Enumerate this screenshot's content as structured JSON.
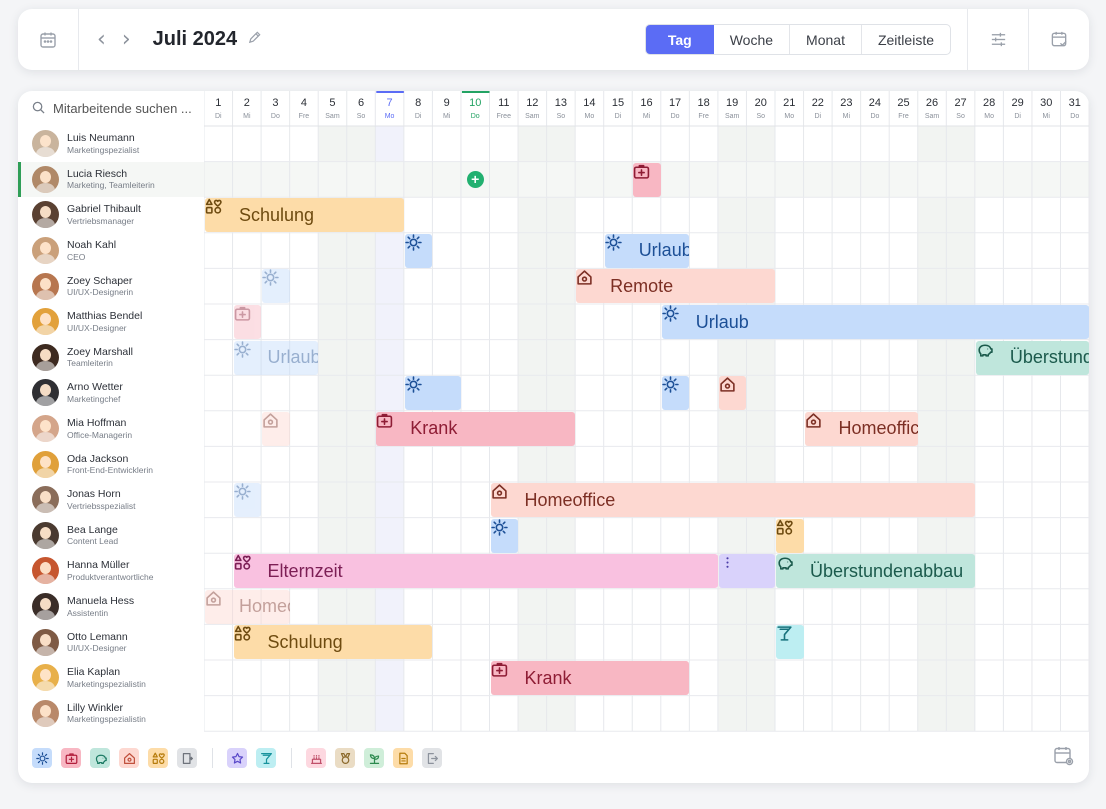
{
  "header": {
    "title": "Juli 2024",
    "views": [
      "Tag",
      "Woche",
      "Monat",
      "Zeitleiste"
    ],
    "active_view": "Tag"
  },
  "search": {
    "placeholder": "Mitarbeitende suchen ..."
  },
  "days": [
    {
      "n": "1",
      "w": "Di"
    },
    {
      "n": "2",
      "w": "Mi"
    },
    {
      "n": "3",
      "w": "Do"
    },
    {
      "n": "4",
      "w": "Fre"
    },
    {
      "n": "5",
      "w": "Sam"
    },
    {
      "n": "6",
      "w": "So"
    },
    {
      "n": "7",
      "w": "Mo"
    },
    {
      "n": "8",
      "w": "Di"
    },
    {
      "n": "9",
      "w": "Mi"
    },
    {
      "n": "10",
      "w": "Do"
    },
    {
      "n": "11",
      "w": "Free"
    },
    {
      "n": "12",
      "w": "Sam"
    },
    {
      "n": "13",
      "w": "So"
    },
    {
      "n": "14",
      "w": "Mo"
    },
    {
      "n": "15",
      "w": "Di"
    },
    {
      "n": "16",
      "w": "Mi"
    },
    {
      "n": "17",
      "w": "Do"
    },
    {
      "n": "18",
      "w": "Fre"
    },
    {
      "n": "19",
      "w": "Sam"
    },
    {
      "n": "20",
      "w": "So"
    },
    {
      "n": "21",
      "w": "Mo"
    },
    {
      "n": "22",
      "w": "Di"
    },
    {
      "n": "23",
      "w": "Mi"
    },
    {
      "n": "24",
      "w": "Do"
    },
    {
      "n": "25",
      "w": "Fre"
    },
    {
      "n": "26",
      "w": "Sam"
    },
    {
      "n": "27",
      "w": "So"
    },
    {
      "n": "28",
      "w": "Mo"
    },
    {
      "n": "29",
      "w": "Di"
    },
    {
      "n": "30",
      "w": "Mi"
    },
    {
      "n": "31",
      "w": "Do"
    }
  ],
  "weekend_days": [
    5,
    6,
    12,
    13,
    19,
    20,
    26,
    27
  ],
  "highlight_day": 7,
  "today": 10,
  "employees": [
    {
      "name": "Luis Neumann",
      "role": "Marketingspezialist",
      "avatar": "#c9b49d"
    },
    {
      "name": "Lucia Riesch",
      "role": "Marketing, Teamleiterin",
      "avatar": "#b08968",
      "selected": true
    },
    {
      "name": "Gabriel Thibault",
      "role": "Vertriebsmanager",
      "avatar": "#5a4132"
    },
    {
      "name": "Noah Kahl",
      "role": "CEO",
      "avatar": "#caa07a"
    },
    {
      "name": "Zoey Schaper",
      "role": "UI/UX-Designerin",
      "avatar": "#b7764f"
    },
    {
      "name": "Matthias Bendel",
      "role": "UI/UX-Designer",
      "avatar": "#e2a13b"
    },
    {
      "name": "Zoey Marshall",
      "role": "Teamleiterin",
      "avatar": "#3d2a20"
    },
    {
      "name": "Arno Wetter",
      "role": "Marketingchef",
      "avatar": "#2f2f33"
    },
    {
      "name": "Mia Hoffman",
      "role": "Office-Managerin",
      "avatar": "#d4a58a"
    },
    {
      "name": "Oda Jackson",
      "role": "Front-End-Entwicklerin",
      "avatar": "#e0a03a"
    },
    {
      "name": "Jonas Horn",
      "role": "Vertriebsspezialist",
      "avatar": "#8a6d5a"
    },
    {
      "name": "Bea Lange",
      "role": "Content Lead",
      "avatar": "#4a3a30"
    },
    {
      "name": "Hanna Müller",
      "role": "Produktverantwortliche",
      "avatar": "#c6562f"
    },
    {
      "name": "Manuela Hess",
      "role": "Assistentin",
      "avatar": "#3a2d28"
    },
    {
      "name": "Otto Lemann",
      "role": "UI/UX-Designer",
      "avatar": "#7e5a44"
    },
    {
      "name": "Elia Kaplan",
      "role": "Marketingspezialistin",
      "avatar": "#e8b04a"
    },
    {
      "name": "Lilly Winkler",
      "role": "Marketingspezialistin",
      "avatar": "#b9896a"
    }
  ],
  "absence_types": {
    "urlaub": {
      "bg": "#c5dcfb",
      "fg": "#1c4f96",
      "icon": "sun-icon"
    },
    "krank": {
      "bg": "#f8b7c3",
      "fg": "#8e1d35",
      "icon": "medical-case-icon"
    },
    "schulung": {
      "bg": "#fddca8",
      "fg": "#6e4b10",
      "icon": "shapes-icon"
    },
    "remote": {
      "bg": "#fdd8d1",
      "fg": "#7c2f24",
      "icon": "house-icon"
    },
    "homeoffice": {
      "bg": "#fdd8d1",
      "fg": "#7c2f24",
      "icon": "house-icon"
    },
    "elternzeit": {
      "bg": "#f9c1e0",
      "fg": "#7c1f55",
      "icon": "shapes-icon"
    },
    "ueberstunden": {
      "bg": "#bfe6dc",
      "fg": "#1b5a4c",
      "icon": "piggy-bank-icon"
    },
    "event": {
      "bg": "#bdeef2",
      "fg": "#17727c",
      "icon": "cocktail-icon"
    },
    "more": {
      "bg": "#d9d2fb",
      "fg": "#4b3da8",
      "icon": "more-icon"
    }
  },
  "events": [
    {
      "row": 1,
      "start": 16,
      "end": 16,
      "type": "krank",
      "label": ""
    },
    {
      "row": 2,
      "start": 1,
      "end": 7,
      "type": "schulung",
      "label": "Schulung"
    },
    {
      "row": 3,
      "start": 8,
      "end": 8,
      "type": "urlaub",
      "label": ""
    },
    {
      "row": 3,
      "start": 15,
      "end": 17,
      "type": "urlaub",
      "label": "Urlaub"
    },
    {
      "row": 4,
      "start": 3,
      "end": 3,
      "type": "urlaub",
      "label": "",
      "faded": true
    },
    {
      "row": 4,
      "start": 14,
      "end": 20,
      "type": "remote",
      "label": "Remote"
    },
    {
      "row": 5,
      "start": 2,
      "end": 2,
      "type": "krank",
      "label": "",
      "faded": true,
      "hatched": true
    },
    {
      "row": 5,
      "start": 17,
      "end": 31,
      "type": "urlaub",
      "label": "Urlaub"
    },
    {
      "row": 6,
      "start": 2,
      "end": 4,
      "type": "urlaub",
      "label": "Urlaub",
      "faded": true
    },
    {
      "row": 6,
      "start": 28,
      "end": 31,
      "type": "ueberstunden",
      "label": "Überstundenabbau"
    },
    {
      "row": 7,
      "start": 8,
      "end": 9,
      "type": "urlaub",
      "label": ""
    },
    {
      "row": 7,
      "start": 17,
      "end": 17,
      "type": "urlaub",
      "label": ""
    },
    {
      "row": 7,
      "start": 19,
      "end": 19,
      "type": "homeoffice",
      "label": ""
    },
    {
      "row": 8,
      "start": 3,
      "end": 3,
      "type": "homeoffice",
      "label": "",
      "faded": true,
      "hatched": true
    },
    {
      "row": 8,
      "start": 7,
      "end": 13,
      "type": "krank",
      "label": "Krank"
    },
    {
      "row": 8,
      "start": 22,
      "end": 25,
      "type": "homeoffice",
      "label": "Homeoffice"
    },
    {
      "row": 10,
      "start": 2,
      "end": 2,
      "type": "urlaub",
      "label": "",
      "faded": true
    },
    {
      "row": 10,
      "start": 11,
      "end": 27,
      "type": "homeoffice",
      "label": "Homeoffice",
      "hatched": true
    },
    {
      "row": 11,
      "start": 11,
      "end": 11,
      "type": "urlaub",
      "label": ""
    },
    {
      "row": 11,
      "start": 21,
      "end": 21,
      "type": "schulung",
      "label": ""
    },
    {
      "row": 12,
      "start": 2,
      "end": 18,
      "type": "elternzeit",
      "label": "Elternzeit"
    },
    {
      "row": 12,
      "start": 19,
      "end": 20,
      "type": "more",
      "label": ""
    },
    {
      "row": 12,
      "start": 21,
      "end": 27,
      "type": "ueberstunden",
      "label": "Überstundenabbau"
    },
    {
      "row": 13,
      "start": 1,
      "end": 3,
      "type": "homeoffice",
      "label": "Homeoffice",
      "faded": true,
      "hatched": true
    },
    {
      "row": 14,
      "start": 2,
      "end": 8,
      "type": "schulung",
      "label": "Schulung"
    },
    {
      "row": 14,
      "start": 21,
      "end": 21,
      "type": "event",
      "label": ""
    },
    {
      "row": 15,
      "start": 11,
      "end": 17,
      "type": "krank",
      "label": "Krank"
    }
  ],
  "add_marker": {
    "row": 1,
    "day": 10
  },
  "legend": {
    "group1": [
      {
        "icon": "sun-icon",
        "bg": "#c5dcfb",
        "fg": "#1c4f96"
      },
      {
        "icon": "medical-case-icon",
        "bg": "#f8b7c3",
        "fg": "#b11d3b"
      },
      {
        "icon": "piggy-bank-icon",
        "bg": "#bfe6dc",
        "fg": "#1b7a63"
      },
      {
        "icon": "house-icon",
        "bg": "#fdd8d1",
        "fg": "#c0503c"
      },
      {
        "icon": "shapes-icon",
        "bg": "#fddca8",
        "fg": "#b67c0c"
      },
      {
        "icon": "door-icon",
        "bg": "#e1e3e6",
        "fg": "#6e737b"
      }
    ],
    "group2": [
      {
        "icon": "star-icon",
        "bg": "#d9d2fb",
        "fg": "#5a49c9"
      },
      {
        "icon": "cocktail-icon",
        "bg": "#bdeef2",
        "fg": "#17929c"
      }
    ],
    "group3": [
      {
        "icon": "cake-icon",
        "bg": "#fdd8e0",
        "fg": "#c0506a"
      },
      {
        "icon": "medal-icon",
        "bg": "#eadcc4",
        "fg": "#8c6a2c"
      },
      {
        "icon": "plant-icon",
        "bg": "#cfeed9",
        "fg": "#2b8a4e"
      },
      {
        "icon": "document-icon",
        "bg": "#fddca8",
        "fg": "#b67c0c"
      },
      {
        "icon": "exit-icon",
        "bg": "#e1e3e6",
        "fg": "#8c929c"
      }
    ]
  }
}
